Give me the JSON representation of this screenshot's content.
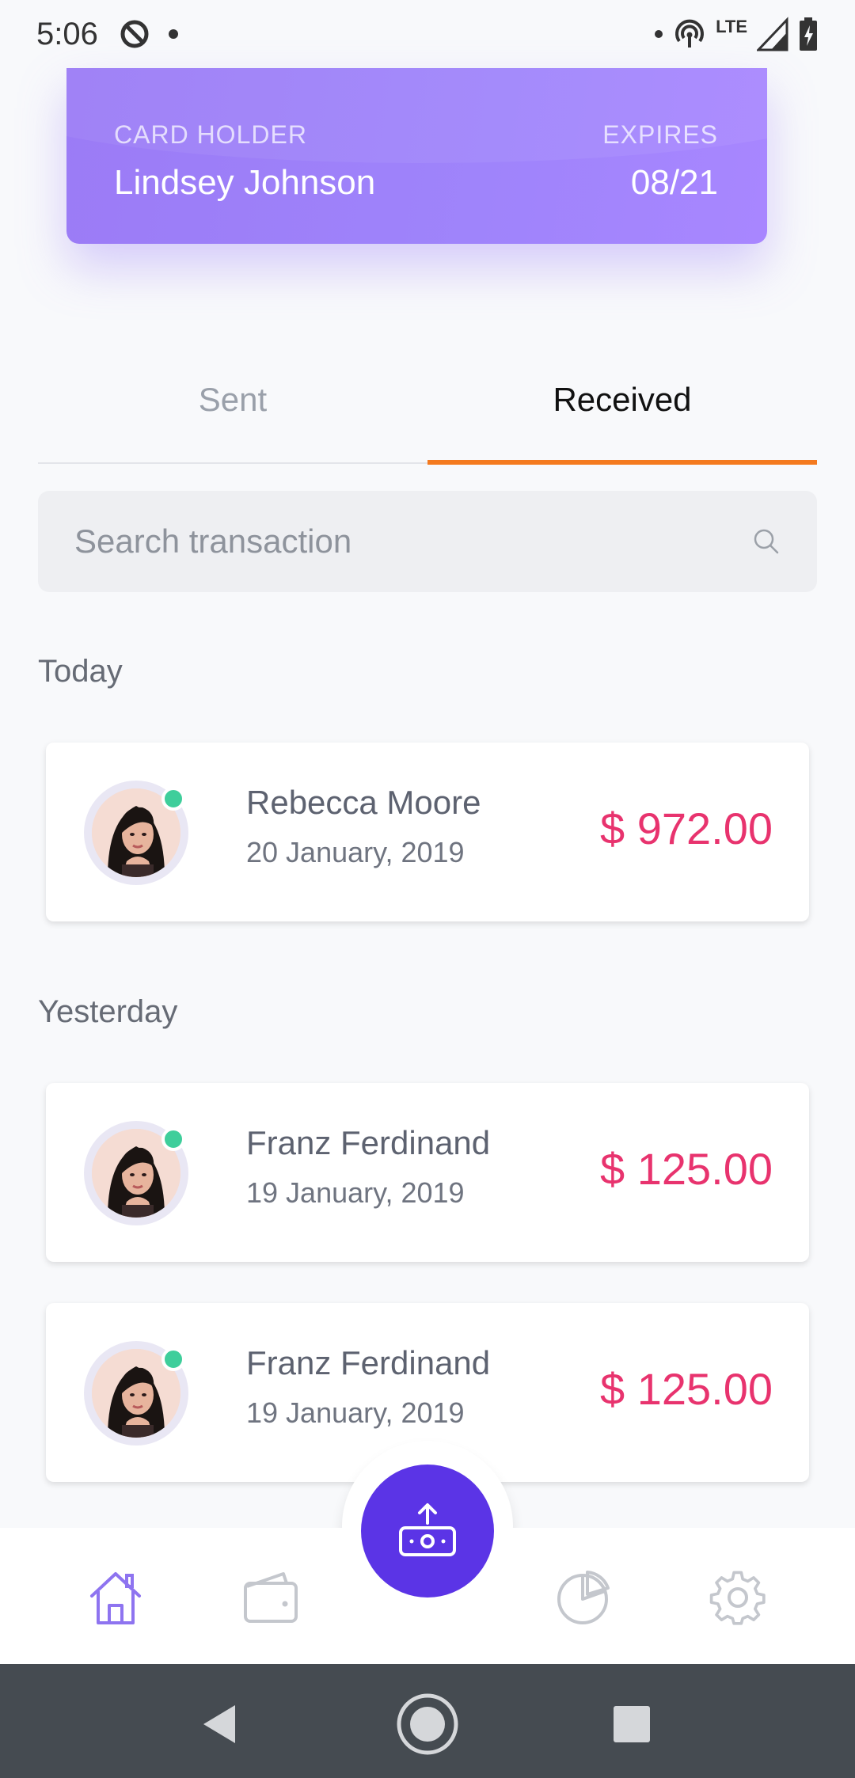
{
  "status_bar": {
    "time": "5:06",
    "network": "LTE"
  },
  "card": {
    "holder_label": "CARD HOLDER",
    "holder_name": "Lindsey Johnson",
    "expires_label": "EXPIRES",
    "expires_value": "08/21"
  },
  "tabs": [
    {
      "label": "Sent",
      "active": false
    },
    {
      "label": "Received",
      "active": true
    }
  ],
  "search": {
    "placeholder": "Search transaction"
  },
  "sections": [
    {
      "title": "Today",
      "transactions": [
        {
          "name": "Rebecca Moore",
          "date": "20 January, 2019",
          "amount": "$ 972.00"
        }
      ]
    },
    {
      "title": "Yesterday",
      "transactions": [
        {
          "name": "Franz Ferdinand",
          "date": "19 January, 2019",
          "amount": "$ 125.00"
        },
        {
          "name": "Franz Ferdinand",
          "date": "19 January, 2019",
          "amount": "$ 125.00"
        }
      ]
    }
  ],
  "bottom_nav": {
    "items": [
      {
        "icon": "home-icon",
        "active": true
      },
      {
        "icon": "wallet-icon",
        "active": false
      },
      {
        "icon": "send-money-icon",
        "active": false
      },
      {
        "icon": "pie-chart-icon",
        "active": false
      },
      {
        "icon": "gear-icon",
        "active": false
      }
    ]
  },
  "colors": {
    "accent": "#5b34e6",
    "card": "#9f84fb",
    "tab_indicator": "#f47a1f",
    "amount": "#e8336e",
    "online": "#3fce9b"
  }
}
